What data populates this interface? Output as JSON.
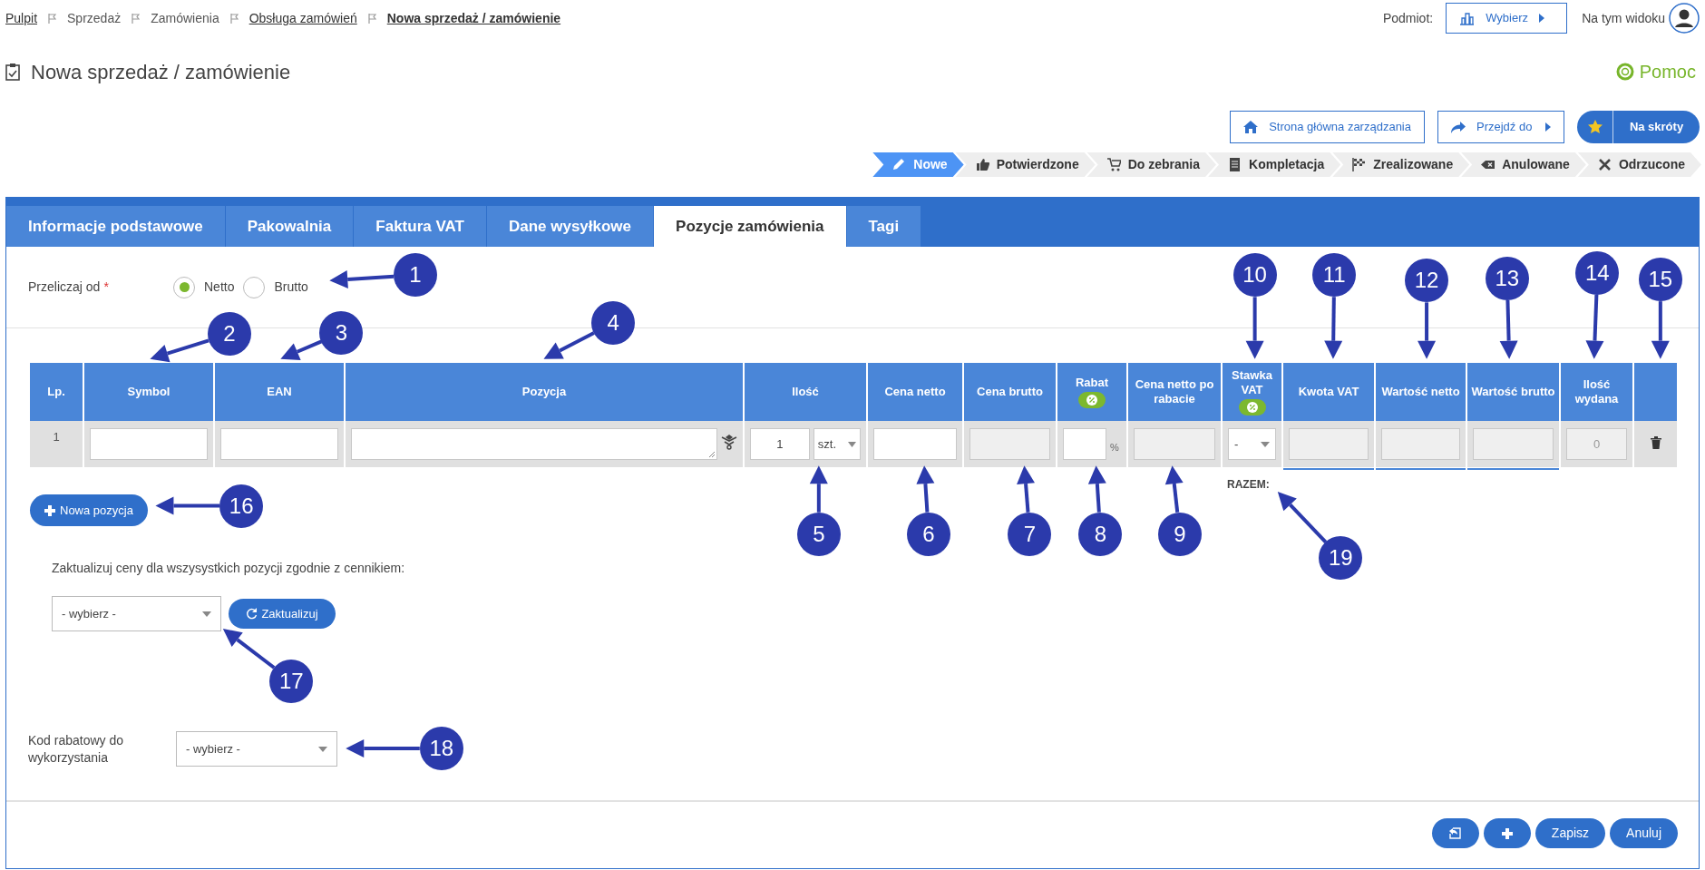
{
  "breadcrumb": [
    {
      "label": "Pulpit",
      "kind": "link"
    },
    {
      "label": "Sprzedaż",
      "kind": "plain"
    },
    {
      "label": "Zamówienia",
      "kind": "plain"
    },
    {
      "label": "Obsługa zamówień",
      "kind": "link"
    },
    {
      "label": "Nowa sprzedaż / zamówienie",
      "kind": "current"
    }
  ],
  "subject": {
    "label": "Podmiot:",
    "button": "Wybierz"
  },
  "view": {
    "label": "Na tym widoku"
  },
  "page_title": "Nowa sprzedaż / zamówienie",
  "help": "Pomoc",
  "actions": [
    {
      "label": "Strona główna zarządzania",
      "kind": "home"
    },
    {
      "label": "Przejdź do",
      "kind": "goto"
    },
    {
      "label": "Na skróty",
      "kind": "shortcuts"
    }
  ],
  "status_steps": [
    {
      "label": "Nowe",
      "selected": true
    },
    {
      "label": "Potwierdzone",
      "selected": false
    },
    {
      "label": "Do zebrania",
      "selected": false
    },
    {
      "label": "Kompletacja",
      "selected": false
    },
    {
      "label": "Zrealizowane",
      "selected": false
    },
    {
      "label": "Anulowane",
      "selected": false
    },
    {
      "label": "Odrzucone",
      "selected": false
    }
  ],
  "tabs": [
    {
      "label": "Informacje podstawowe",
      "selected": false
    },
    {
      "label": "Pakowalnia",
      "selected": false
    },
    {
      "label": "Faktura VAT",
      "selected": false
    },
    {
      "label": "Dane wysyłkowe",
      "selected": false
    },
    {
      "label": "Pozycje zamówienia",
      "selected": true
    },
    {
      "label": "Tagi",
      "selected": false
    }
  ],
  "recalc": {
    "label": "Przeliczaj od",
    "required_mark": "*",
    "options": [
      {
        "label": "Netto",
        "selected": true
      },
      {
        "label": "Brutto",
        "selected": false
      }
    ]
  },
  "table": {
    "columns": [
      {
        "label": "Lp.",
        "badge": false
      },
      {
        "label": "Symbol",
        "badge": false
      },
      {
        "label": "EAN",
        "badge": false
      },
      {
        "label": "Pozycja",
        "badge": false
      },
      {
        "label": "Ilość",
        "badge": false
      },
      {
        "label": "Cena netto",
        "badge": false
      },
      {
        "label": "Cena brutto",
        "badge": false
      },
      {
        "label": "Rabat",
        "badge": true
      },
      {
        "label": "Cena netto po rabacie",
        "badge": false
      },
      {
        "label": "Stawka VAT",
        "badge": true
      },
      {
        "label": "Kwota VAT",
        "badge": false
      },
      {
        "label": "Wartość netto",
        "badge": false
      },
      {
        "label": "Wartość brutto",
        "badge": false
      },
      {
        "label": "Ilość wydana",
        "badge": false
      },
      {
        "badge": false
      }
    ],
    "rows": [
      {
        "cells": [
          {
            "kind": "index",
            "value": "1"
          },
          {
            "kind": "input"
          },
          {
            "kind": "input"
          },
          {
            "kind": "textarea"
          },
          {
            "kind": "quantity",
            "value": "1",
            "unit": "szt."
          },
          {
            "kind": "input"
          },
          {
            "kind": "readonly"
          },
          {
            "kind": "percent",
            "unit": "%"
          },
          {
            "kind": "readonly"
          },
          {
            "kind": "select",
            "value": "-"
          },
          {
            "kind": "sum"
          },
          {
            "kind": "sum"
          },
          {
            "kind": "sum"
          },
          {
            "kind": "readonly",
            "placeholder": "0"
          },
          {
            "kind": "delete"
          }
        ]
      }
    ]
  },
  "total_label": "RAZEM:",
  "new_item_button": "Nowa pozycja",
  "price_update": {
    "text": "Zaktualizuj ceny dla wszysystkich pozycji zgodnie z cennikiem:",
    "select": "- wybierz -",
    "button": "Zaktualizuj"
  },
  "discount_code": {
    "label": "Kod rabatowy do wykorzystania",
    "select": "- wybierz -"
  },
  "footer_buttons": [
    {
      "kind": "restore"
    },
    {
      "kind": "add"
    },
    {
      "kind": "text",
      "label": "Zapisz"
    },
    {
      "kind": "text",
      "label": "Anuluj"
    }
  ],
  "callouts": [
    "1",
    "2",
    "3",
    "4",
    "5",
    "6",
    "7",
    "8",
    "9",
    "10",
    "11",
    "12",
    "13",
    "14",
    "15",
    "16",
    "17",
    "18",
    "19"
  ]
}
